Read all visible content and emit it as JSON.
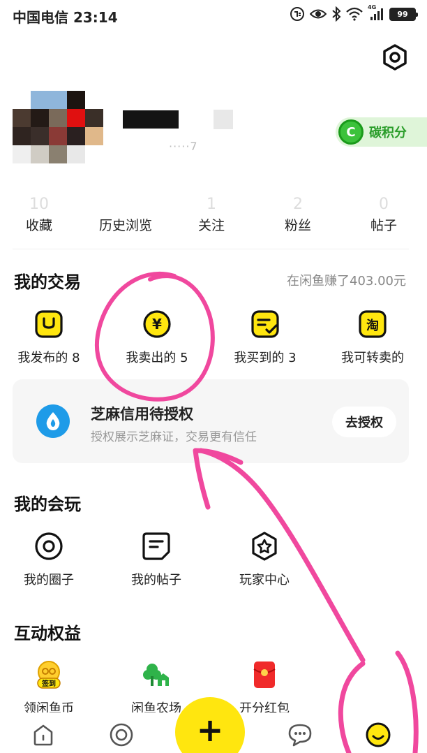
{
  "status_bar": {
    "carrier_time": "中国电信 23:14",
    "network": "4G",
    "battery": "99"
  },
  "profile": {
    "user_id": "·····7"
  },
  "carbon": {
    "icon_letter": "C",
    "label": "碳积分"
  },
  "stats": [
    {
      "num": "10",
      "label": "收藏"
    },
    {
      "num": "",
      "label": "历史浏览"
    },
    {
      "num": "1",
      "label": "关注"
    },
    {
      "num": "2",
      "label": "粉丝"
    },
    {
      "num": "0",
      "label": "帖子"
    }
  ],
  "trading": {
    "title": "我的交易",
    "earned": "在闲鱼赚了403.00元",
    "items": [
      {
        "label": "我发布的 8",
        "icon": "published-icon"
      },
      {
        "label": "我卖出的 5",
        "icon": "yen-icon"
      },
      {
        "label": "我买到的 3",
        "icon": "bought-icon"
      },
      {
        "label": "我可转卖的",
        "icon": "taobao-icon"
      }
    ],
    "yen_glyph": "¥",
    "taobao_glyph": "淘"
  },
  "credit": {
    "title": "芝麻信用待授权",
    "subtitle": "授权展示芝麻证，交易更有信任",
    "button": "去授权"
  },
  "play": {
    "title": "我的会玩",
    "items": [
      {
        "label": "我的圈子",
        "icon": "circle-icon"
      },
      {
        "label": "我的帖子",
        "icon": "post-icon"
      },
      {
        "label": "玩家中心",
        "icon": "star-icon"
      }
    ]
  },
  "benefits": {
    "title": "互动权益",
    "items": [
      {
        "label": "领闲鱼币",
        "icon": "coin-icon",
        "badge": "签到"
      },
      {
        "label": "闲鱼农场",
        "icon": "farm-icon"
      },
      {
        "label": "开分红包",
        "icon": "red-envelope-icon"
      }
    ]
  },
  "bottom_nav": {
    "fab_glyph": "+"
  },
  "colors": {
    "accent_yellow": "#ffe60f",
    "annotation_pink": "#f0489e",
    "carbon_green": "#3cc23b",
    "alipay_blue": "#1e9be8"
  }
}
